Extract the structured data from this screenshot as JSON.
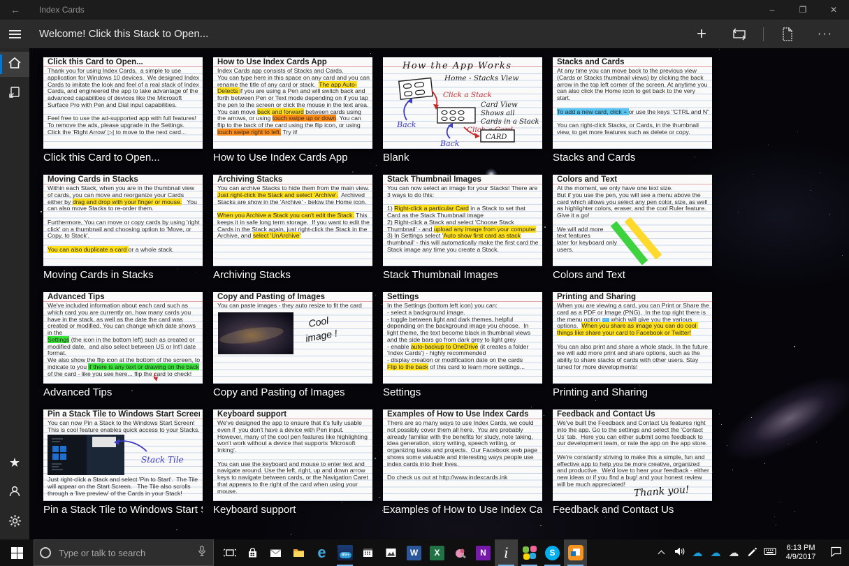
{
  "colors": {
    "accent": "#0078d7",
    "highlight_yellow": "#ffe01a",
    "highlight_orange": "#ff8b17",
    "highlight_blue": "#59c5f2",
    "highlight_green": "#37e437"
  },
  "window": {
    "app_title": "Index Cards",
    "back_glyph": "←",
    "minimize": "–",
    "maximize": "❐",
    "close": "✕"
  },
  "appbar": {
    "title": "Welcome! Click this Stack to Open...",
    "add_glyph": "+",
    "more_glyph": "···"
  },
  "taskbar": {
    "search_placeholder": "Type or talk to search",
    "clock_time": "6:13 PM",
    "clock_date": "4/9/2017",
    "apps": [
      {
        "id": "task-view",
        "name": "task-view-button"
      },
      {
        "id": "store",
        "name": "store-icon"
      },
      {
        "id": "mail",
        "name": "mail-icon"
      },
      {
        "id": "explorer",
        "name": "file-explorer-icon"
      },
      {
        "id": "edge",
        "name": "edge-icon",
        "letter": "e"
      },
      {
        "id": "badge",
        "name": "mail-unread-icon",
        "badge": "99+",
        "open": true
      },
      {
        "id": "calendar",
        "name": "calendar-icon"
      },
      {
        "id": "photos",
        "name": "photos-icon"
      },
      {
        "id": "word",
        "name": "word-icon",
        "letter": "W",
        "color": "#2b579a"
      },
      {
        "id": "excel",
        "name": "excel-icon",
        "letter": "X",
        "color": "#217346"
      },
      {
        "id": "paint",
        "name": "paint-app-icon"
      },
      {
        "id": "onenote",
        "name": "onenote-icon",
        "letter": "N",
        "color": "#7719aa"
      },
      {
        "id": "indexcards",
        "name": "index-cards-taskbar-icon",
        "letter": "i",
        "open": true,
        "focused": true
      },
      {
        "id": "colorgrid",
        "name": "color-grid-app-icon",
        "open": true
      },
      {
        "id": "skype",
        "name": "skype-icon",
        "letter": "S",
        "open": true
      },
      {
        "id": "cube",
        "name": "orange-cube-app-icon",
        "open": true,
        "focused": true
      }
    ]
  },
  "cards": [
    {
      "title": "Click this Card to Open...",
      "caption": "Click this Card to Open...",
      "body": [
        {
          "t": "Thank you for using Index Cards,  a simple to use application for Windows 10 devices.  We designed Index Cards to imitate the look and feel of a real stack of Index Cards, and engineered the app to take advantage of the advanced capabilities of devices like the Microsoft Surface Pro with Pen and Dial input capabilities.\n\nFeel free to use the ad-supported app with full features!\nTo remove the ads, please upgrade in the Settings.\nClick the 'Right Arrow' ▷| to move to the next card..."
        }
      ]
    },
    {
      "title": "How to Use Index Cards App",
      "caption": "How to Use Index Cards App",
      "body": [
        {
          "t": "Index Cards app consists of Stacks and Cards.\nYou can type here in this space on any card and you can rename the title of any card or stack.  "
        },
        {
          "t": "The app Auto-Detects ",
          "h": "y"
        },
        {
          "t": "if you are using a Pen and will switch back and forth between Pen or Text mode depending on if you tap the pen to the screen or click the mouse in the text area.\nYou can move "
        },
        {
          "t": "back and forward",
          "h": "y"
        },
        {
          "t": " between cards using the arrows, or using "
        },
        {
          "t": "touch swipe up or down",
          "h": "o"
        },
        {
          "t": ". You can flip to the back of the card using the flip icon, or using "
        },
        {
          "t": "touch swipe right to left.",
          "h": "o"
        },
        {
          "t": " Try it!"
        }
      ]
    },
    {
      "title": "",
      "caption": "Blank",
      "body": [],
      "sketch": "app-works",
      "sketch_labels": {
        "heading": "How  the  App  Works",
        "home": "Home  -  Stacks View",
        "click_stack": "Click a Stack",
        "card_view": "Card View",
        "shows_all": "Shows all",
        "cards_in": "Cards in a Stack",
        "back1": "Back",
        "back2": "Back",
        "click_card": "Click a Card",
        "card": "CARD"
      }
    },
    {
      "title": "Stacks and Cards",
      "caption": "Stacks and Cards",
      "body": [
        {
          "t": "At any time you can move back to the previous view (Cards or Stacks thumbnail views) by clicking the back arrow in the top left corner of the screen. At anytime you can also click the Home icon to get back to the very start.\n\n"
        },
        {
          "t": "To add a new card, click + ",
          "h": "b"
        },
        {
          "t": "or use the keys \"CTRL and N\"\n\nYou can right-click Stacks, or Cards, in the thumbnail view, to get more features such as delete or copy."
        }
      ]
    },
    {
      "title": "Moving Cards in Stacks",
      "caption": "Moving Cards in Stacks",
      "body": [
        {
          "t": "Within each Stack, when you are in the thumbnail view of cards, you can move and reorganize your Cards either by "
        },
        {
          "t": "drag and drop with your finger or mouse.",
          "h": "y"
        },
        {
          "t": "   You can also move Stacks to re-order them.\n\nFurthermore, You can move or copy cards by using 'right click' on a thumbnail and choosing option to 'Move, or Copy, to Stack'.\n\n"
        },
        {
          "t": "You can also duplicate a card ",
          "h": "y"
        },
        {
          "t": "or a whole stack."
        }
      ]
    },
    {
      "title": "Archiving Stacks",
      "caption": "Archiving Stacks",
      "body": [
        {
          "t": "You can archive Stacks to hide them from the main view. "
        },
        {
          "t": "Just right-click the Stack and select 'Archive'.",
          "h": "y"
        },
        {
          "t": "  Archived Stacks are show in the 'Archive' - below the Home icon.\n\n"
        },
        {
          "t": "When you Archive a Stack you can't edit the Stack.",
          "h": "y"
        },
        {
          "t": " This keeps it in safe long term storage.  If you want to edit the Cards in the Stack again, just right-click the Stack in the Archive, and "
        },
        {
          "t": "select 'UnArchive'",
          "h": "y"
        }
      ]
    },
    {
      "title": "Stack Thumbnail Images",
      "caption": "Stack Thumbnail Images",
      "body": [
        {
          "t": "You can now select an image for your Stacks! There are 3 ways to do this:\n\n1) "
        },
        {
          "t": "Right-click a particular Card",
          "h": "y"
        },
        {
          "t": " in a Stack to set that Card as the Stack Thumbnail image\n2) Right-click a Stack and select 'Choose Stack Thumbnail' - and "
        },
        {
          "t": "upload any image from your computer",
          "h": "y"
        },
        {
          "t": "\n3) In Settings select '"
        },
        {
          "t": "Auto show first card as stack",
          "h": "y"
        },
        {
          "t": " thumbnail' - this will automatically make the first card the Stack image any time you create a Stack."
        }
      ]
    },
    {
      "title": "Colors and Text",
      "caption": "Colors and Text",
      "sketch": "color-strokes",
      "body": [
        {
          "t": "At the moment, we only have one text size.\nBut if you use the pen, you will see a menu above the card which allows you select any pen color, size, as well as highlighter colors, eraser, and the cool Ruler feature.\nGive it a go!\n\nWe will add more\ntext features\nlater for keyboard only\nusers."
        }
      ]
    },
    {
      "title": "Advanced Tips",
      "caption": "Advanced Tips",
      "sketch": "flip-hint",
      "body": [
        {
          "t": "We've included information about each card such as which card you are currently on, how many cards you have in the stack, as well as the date the card was created or modified. You can change which date shows in the\n"
        },
        {
          "t": "Settings",
          "h": "g"
        },
        {
          "t": " (the icon in the bottom left) such as created or modified date,  and also select between US or Int'l date format.\nWe also show the flip icon at the bottom of the screen, to indicate to you "
        },
        {
          "t": "if there is any text or drawing on the back",
          "h": "g"
        },
        {
          "t": " of the card - like you see here... flip the card to check!"
        }
      ]
    },
    {
      "title": "Copy and Pasting of Images",
      "caption": "Copy and Pasting of Images",
      "sketch": "cool-image",
      "sketch_labels": {
        "line1": "Cool",
        "line2": "image !"
      },
      "body": [
        {
          "t": "You can paste images - they auto resize to fit the card"
        }
      ]
    },
    {
      "title": "Settings",
      "caption": "Settings",
      "body": [
        {
          "t": "In the Settings (bottom left icon) you can:\n- select a background image.\n- toggle between light and dark themes, helpful depending on the background image you choose.  In light theme, the text become black in thumbnail views and the side bars go from dark grey to light grey\n- enable "
        },
        {
          "t": "auto-backup to OneDrive",
          "h": "y"
        },
        {
          "t": " (it creates a folder 'Index Cards') - highly recommended\n- display creation or modification date on the cards\n"
        },
        {
          "t": "Flip to the back",
          "h": "y"
        },
        {
          "t": " of this card to learn more settings..."
        }
      ]
    },
    {
      "title": "Printing and Sharing",
      "caption": "Printing and Sharing",
      "body": [
        {
          "t": "When you are viewing a card, you can Print or Share the card as a PDF or Image (PNG).  In the top right there is the menu option "
        },
        {
          "t": "⋯",
          "h": "ib"
        },
        {
          "t": " which will give you the various options.  "
        },
        {
          "t": "When you share as image you can do cool things like share your card to Facebook or Twitter!",
          "h": "y"
        },
        {
          "t": "\n\nYou can also print and share a whole stack. In the future we will add more print and share options, such as the ability to share stacks of cards with other users. Stay tuned for more developments!"
        }
      ]
    },
    {
      "title": "Pin a Stack Tile to Windows Start Screen",
      "caption": "Pin a Stack Tile to Windows Start Screen",
      "sketch": "start-screen",
      "sketch_labels": {
        "label": "Stack  Tile"
      },
      "body": [
        {
          "t": "You can now Pin a Stack to the Windows Start Screen!\nThis is cool feature enables quick access to your Stacks."
        }
      ],
      "body2": [
        {
          "t": "Just right-click a Stack and select 'Pin to Start'.  The Tile will appear on the Start Screen.   The Tile also scrolls through a 'live preview' of the Cards in your Stack!"
        }
      ]
    },
    {
      "title": "Keyboard support",
      "caption": "Keyboard support",
      "body": [
        {
          "t": "We've designed the app to ensure that it's fully usable even if  you don't have a device with Pen input.  However, many of the cool pen features like highlighting won't work without a device that supports 'Microsoft Inking'.\n\nYou can use the keyboard and mouse to enter text and navigate around. Use the left, right, up and down arrow keys to navigate between cards, or the Navigation Caret that appears to the right of the card when using your mouse."
        }
      ]
    },
    {
      "title": "Examples of How to Use Index Cards",
      "caption": "Examples of How to Use Index Cards",
      "body": [
        {
          "t": "There are so many ways to use Index Cards, we could not possibly cover them all here.  You are probably already familiar with the benefits for study, note taking, idea generation, story writing, speech writing, or organizing tasks and projects.  Our Facebook web page shows some valuable and interesting ways people use index cards into their lives.\n\nDo check us out at http://www.indexcards.ink"
        }
      ]
    },
    {
      "title": "Feedback and Contact Us",
      "caption": "Feedback and Contact Us",
      "sketch": "thank-you",
      "sketch_labels": {
        "label": "Thank you!"
      },
      "body": [
        {
          "t": "We've built the Feedback and Contact Us features right into the app. Go to the settings and select the 'Contact Us' tab.  Here you can either submit some feedback to our development team, or rate the app on the app store.\n\nWe're constantly striving to make this a simple, fun and effective app to help you be more creative, organized and productive.  We'd love to hear your feedback - either new ideas or if you find a bug! and your honest review will be much appreciated!"
        }
      ]
    }
  ]
}
